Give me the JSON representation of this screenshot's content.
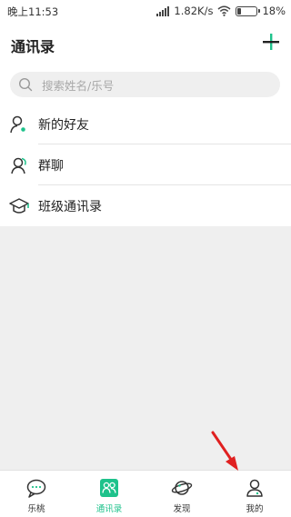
{
  "status_bar": {
    "time": "晚上11:53",
    "network_speed": "1.82K/s",
    "battery": "18%",
    "icons": [
      "signal-icon",
      "wifi-icon",
      "battery-icon"
    ]
  },
  "header": {
    "title": "通讯录",
    "add_icon": "plus-icon"
  },
  "search": {
    "placeholder": "搜索姓名/乐号",
    "icon": "search-icon"
  },
  "list": [
    {
      "label": "新的好友",
      "icon": "add-friend-icon"
    },
    {
      "label": "群聊",
      "icon": "group-chat-icon"
    },
    {
      "label": "班级通讯录",
      "icon": "graduation-cap-icon"
    }
  ],
  "bottom_nav": [
    {
      "label": "乐桃",
      "icon": "chat-bubble-icon",
      "active": false
    },
    {
      "label": "通讯录",
      "icon": "contacts-icon",
      "active": true
    },
    {
      "label": "发现",
      "icon": "planet-icon",
      "active": false
    },
    {
      "label": "我的",
      "icon": "profile-icon",
      "active": false
    }
  ],
  "colors": {
    "accent": "#1ec28b",
    "arrow": "#e02020",
    "background": "#efefef"
  }
}
